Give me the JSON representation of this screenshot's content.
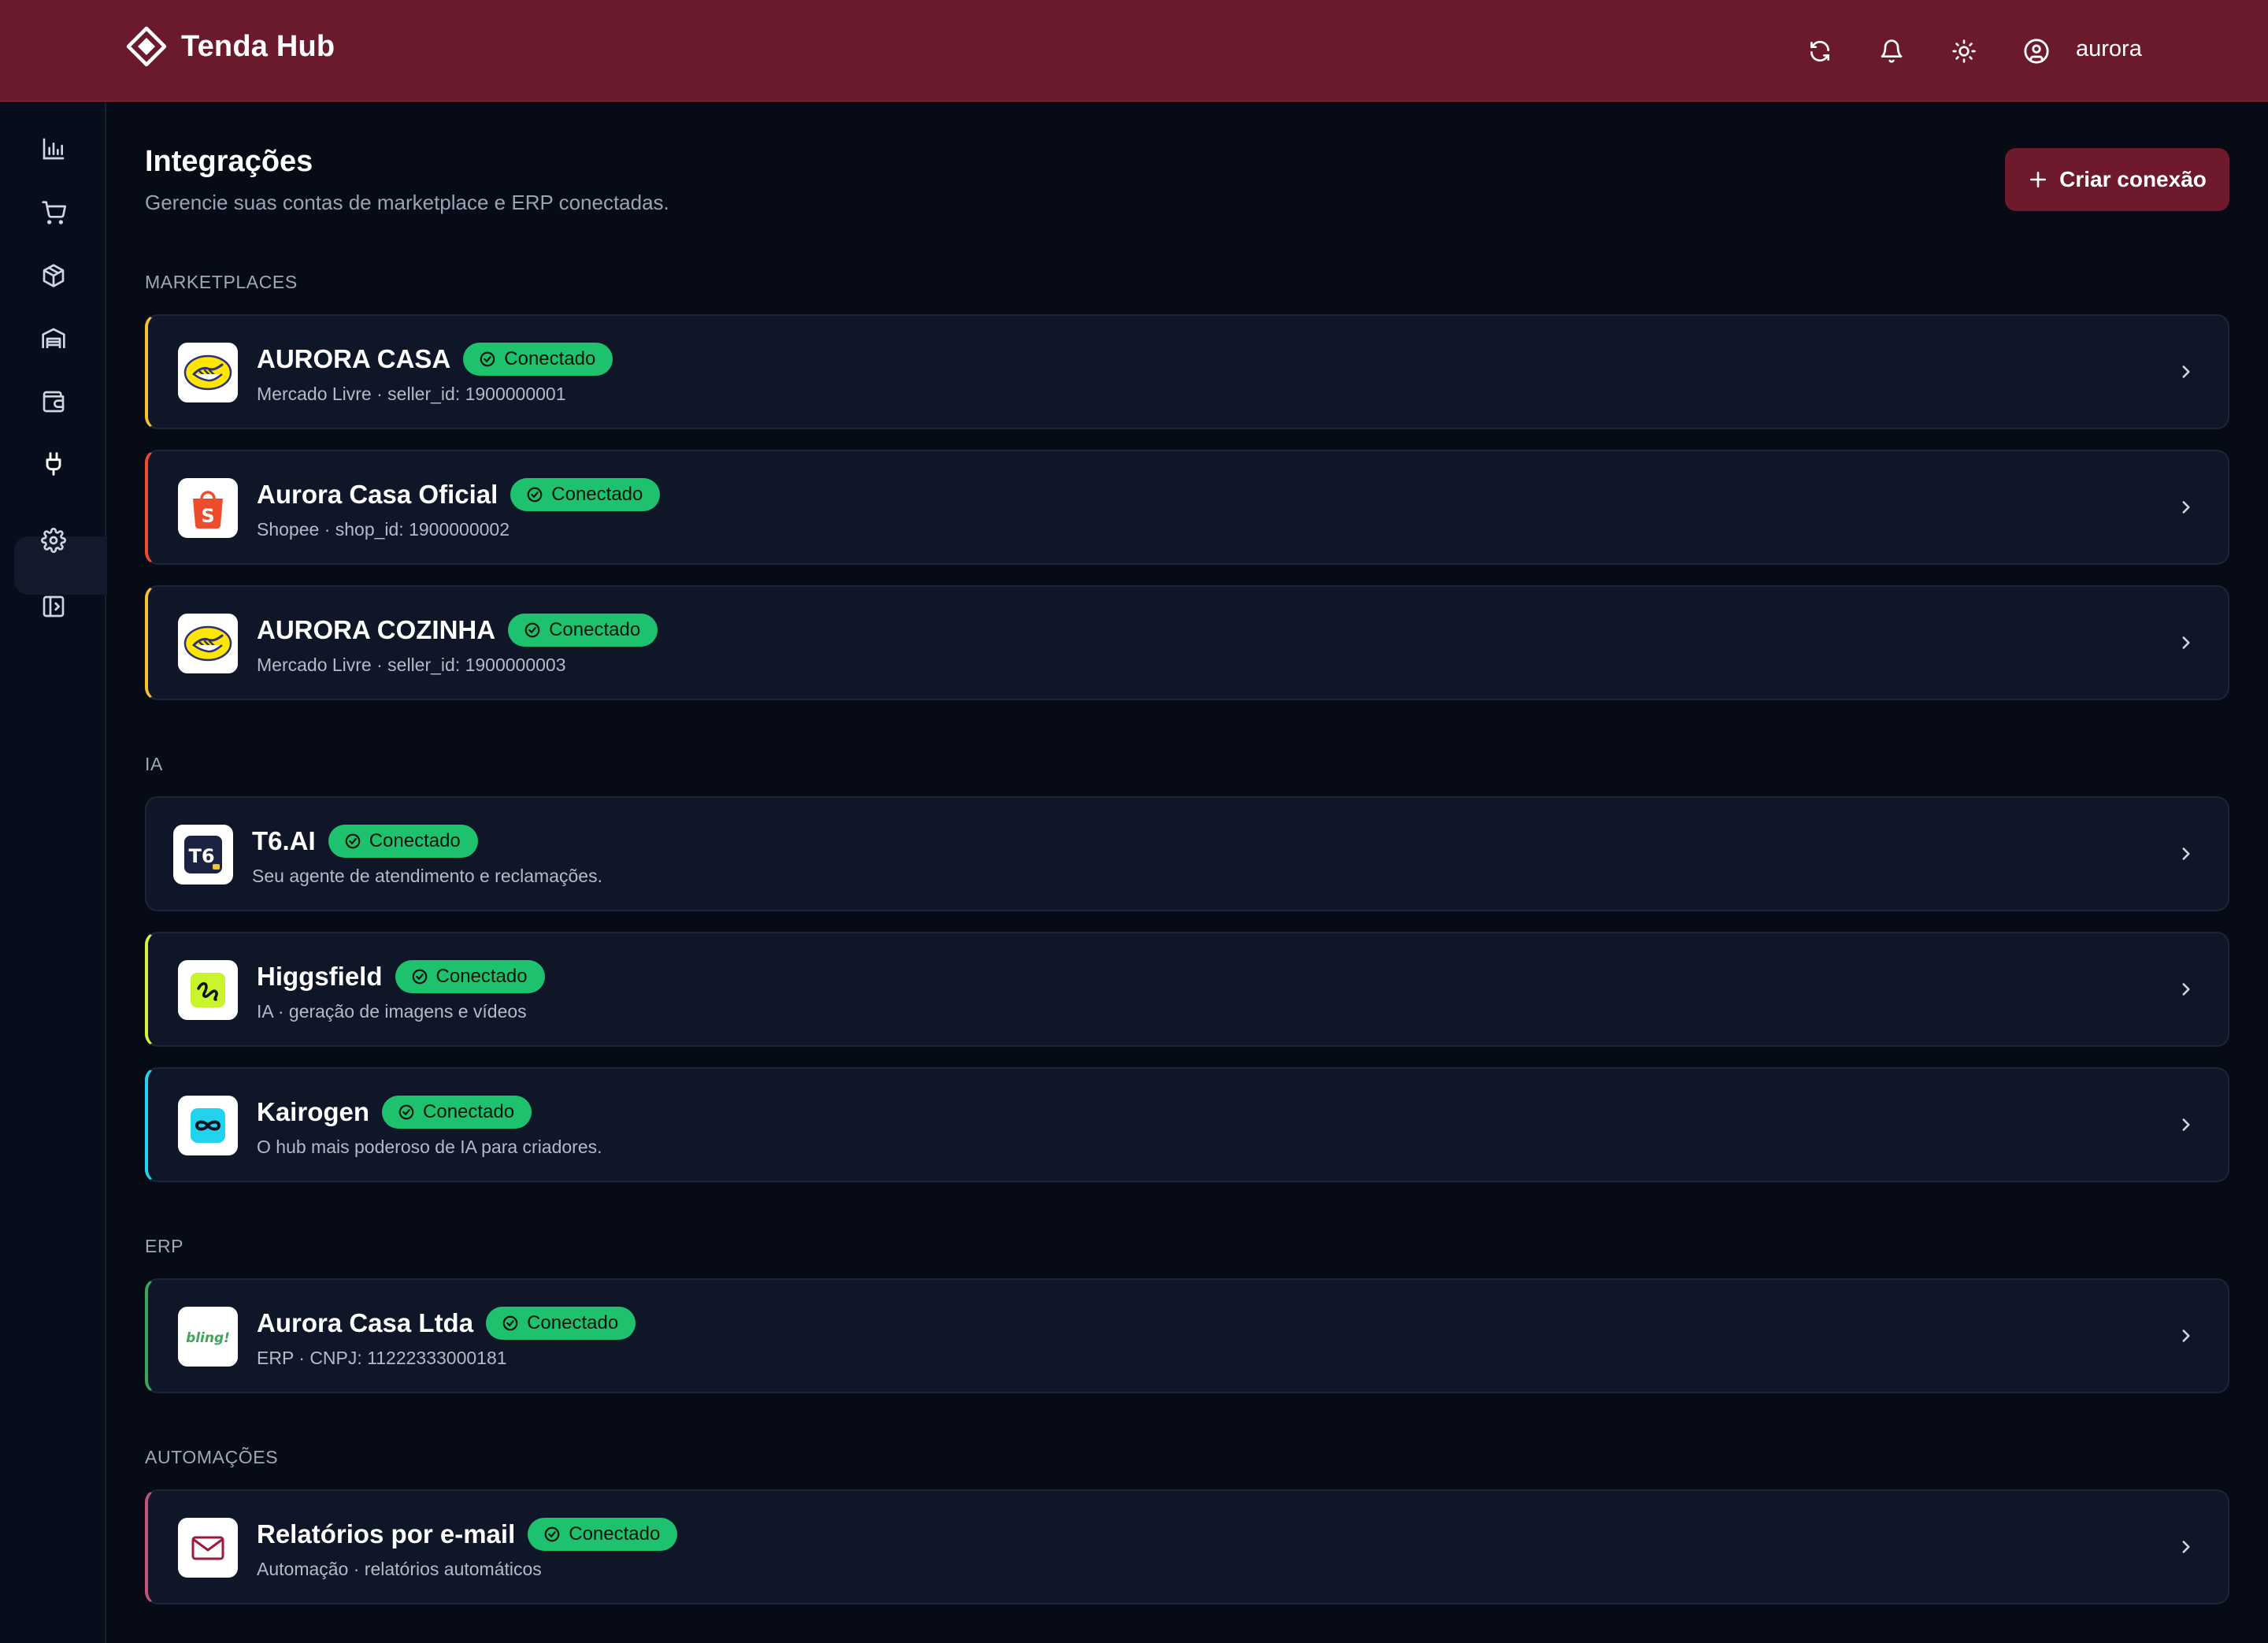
{
  "app": {
    "name": "Tenda Hub"
  },
  "topbar": {
    "icons": [
      "refresh-icon",
      "bell-icon",
      "sun-icon",
      "user-circle-icon"
    ],
    "user_name": "aurora"
  },
  "sidebar": {
    "items": [
      {
        "icon": "bar-chart-icon",
        "active": false
      },
      {
        "icon": "cart-icon",
        "active": false
      },
      {
        "icon": "box-icon",
        "active": false
      },
      {
        "icon": "warehouse-icon",
        "active": false
      },
      {
        "icon": "wallet-icon",
        "active": false
      },
      {
        "icon": "plug-icon",
        "active": true
      },
      {
        "icon": "gear-icon",
        "active": false
      },
      {
        "icon": "sidebar-toggle-icon",
        "active": false
      }
    ]
  },
  "page": {
    "title": "Integrações",
    "subtitle": "Gerencie suas contas de marketplace e ERP conectadas.",
    "create_button": "Criar conexão"
  },
  "sections": [
    {
      "label": "MARKETPLACES",
      "items": [
        {
          "name": "AURORA CASA",
          "status": "Conectado",
          "description": "Mercado Livre · seller_id: 1900000001",
          "accent": "#f4c430",
          "logo": "mercado-livre-logo"
        },
        {
          "name": "Aurora Casa Oficial",
          "status": "Conectado",
          "description": "Shopee · shop_id: 1900000002",
          "accent": "#ee4d2d",
          "logo": "shopee-logo"
        },
        {
          "name": "AURORA COZINHA",
          "status": "Conectado",
          "description": "Mercado Livre · seller_id: 1900000003",
          "accent": "#f4c430",
          "logo": "mercado-livre-logo"
        }
      ]
    },
    {
      "label": "IA",
      "items": [
        {
          "name": "T6.AI",
          "status": "Conectado",
          "description": "Seu agente de atendimento e reclamações.",
          "accent": "#1c2538",
          "logo": "t6-logo",
          "logo_text": "T6"
        },
        {
          "name": "Higgsfield",
          "status": "Conectado",
          "description": "IA · geração de imagens e vídeos",
          "accent": "#d4f53c",
          "logo": "higgsfield-logo"
        },
        {
          "name": "Kairogen",
          "status": "Conectado",
          "description": "O hub mais poderoso de IA para criadores.",
          "accent": "#22d3ee",
          "logo": "kairogen-logo"
        }
      ]
    },
    {
      "label": "ERP",
      "items": [
        {
          "name": "Aurora Casa Ltda",
          "status": "Conectado",
          "description": "ERP · CNPJ: 11222333000181",
          "accent": "#3fa55b",
          "logo": "bling-logo",
          "logo_text": "bling!"
        }
      ]
    },
    {
      "label": "AUTOMAÇÕES",
      "items": [
        {
          "name": "Relatórios por e-mail",
          "status": "Conectado",
          "description": "Automação · relatórios automáticos",
          "accent": "#c0557a",
          "logo": "mail-logo"
        }
      ]
    }
  ],
  "colors": {
    "topbar": "#6b1a2b",
    "background": "#070b16",
    "card": "#0e1628",
    "badge": "#1ec26e",
    "button": "#6e1a2c"
  }
}
